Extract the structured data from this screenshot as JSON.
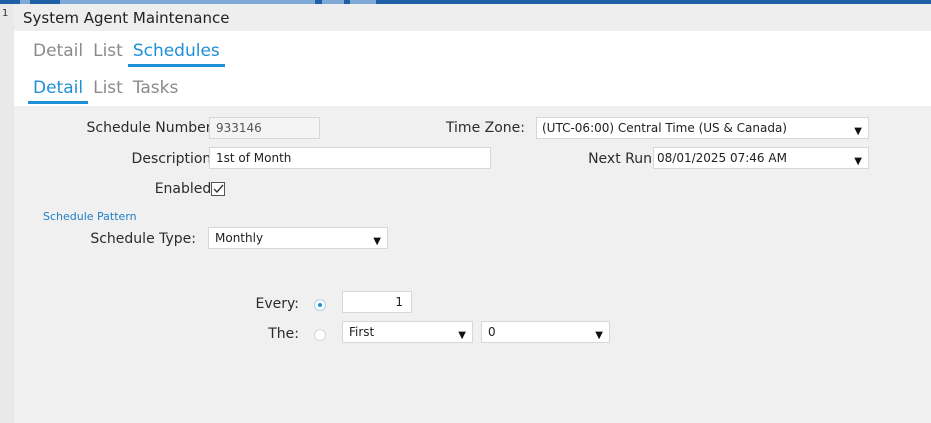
{
  "window": {
    "title": "System Agent Maintenance",
    "left_mark": "1"
  },
  "tabs_primary": [
    {
      "label": "Detail",
      "active": false
    },
    {
      "label": "List",
      "active": false
    },
    {
      "label": "Schedules",
      "active": true
    }
  ],
  "tabs_secondary": [
    {
      "label": "Detail",
      "active": true
    },
    {
      "label": "List",
      "active": false
    },
    {
      "label": "Tasks",
      "active": false
    }
  ],
  "form": {
    "schedule_number": {
      "label": "Schedule Number:",
      "value": "933146"
    },
    "description": {
      "label": "Description:",
      "value": "1st of Month"
    },
    "enabled": {
      "label": "Enabled:",
      "checked": true
    },
    "time_zone": {
      "label": "Time Zone:",
      "value": "(UTC-06:00) Central Time (US & Canada)"
    },
    "next_run": {
      "label": "Next Run",
      "value": "08/01/2025 07:46 AM"
    },
    "section_title": "Schedule Pattern",
    "schedule_type": {
      "label": "Schedule Type:",
      "value": "Monthly"
    },
    "every": {
      "label": "Every:",
      "selected": true,
      "value": "1"
    },
    "the": {
      "label": "The:",
      "selected": false,
      "ordinal": "First",
      "day": "0"
    }
  },
  "icons": {
    "dropdown": "chevron-down-icon",
    "checkbox": "checkmark-icon"
  },
  "colors": {
    "accent": "#1e90d8",
    "topbar": "#1f5fa3",
    "panel": "#f0f0f0"
  }
}
